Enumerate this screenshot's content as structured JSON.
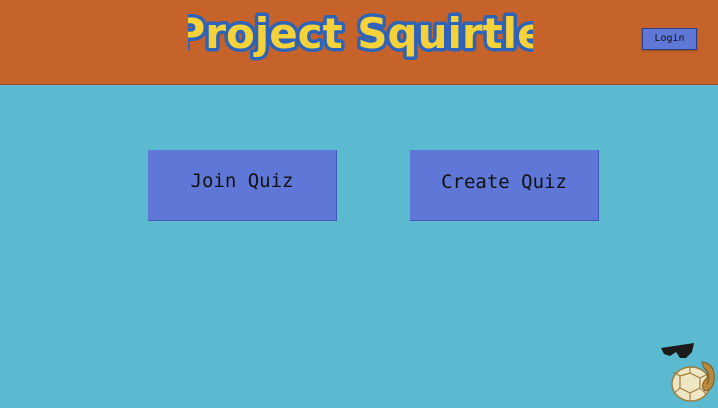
{
  "header": {
    "logo_text": "Project Squirtle",
    "login_label": "Login"
  },
  "main": {
    "join_quiz_label": "Join Quiz",
    "create_quiz_label": "Create Quiz"
  },
  "colors": {
    "header_bg": "#c5632a",
    "page_bg": "#5bbad0",
    "button_bg": "#5f77d6",
    "logo_fill": "#f6d23a",
    "logo_outline": "#2f63b8"
  },
  "icons": {
    "mascot": "squirtle-shell-icon"
  }
}
